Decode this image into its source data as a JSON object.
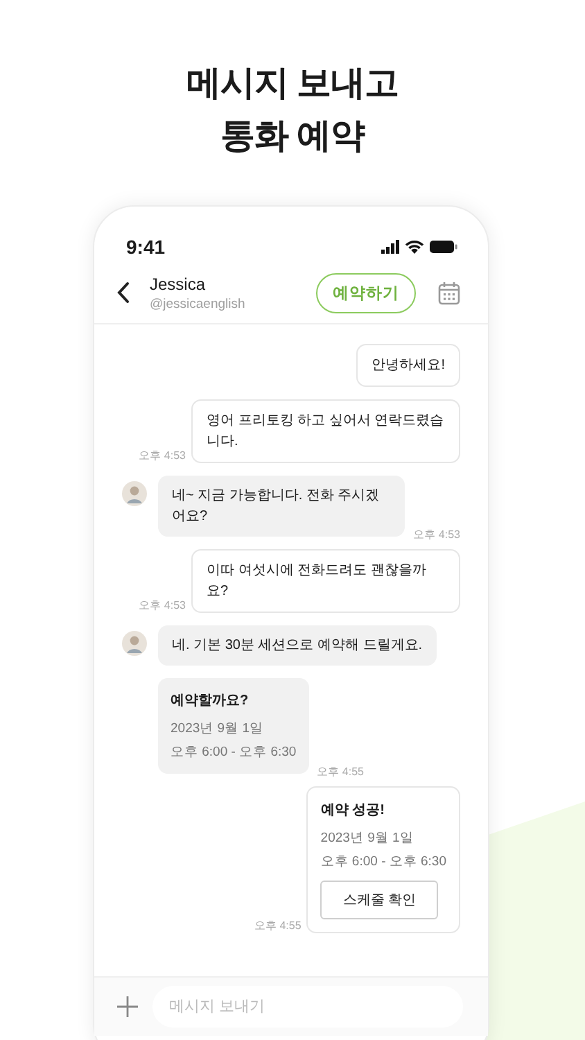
{
  "headline": [
    "메시지 보내고",
    "통화 예약"
  ],
  "status_bar": {
    "time": "9:41"
  },
  "chat_header": {
    "name": "Jessica",
    "handle": "@jessicaenglish",
    "book_button": "예약하기"
  },
  "messages": [
    {
      "outgoing": true,
      "kind": "text",
      "text": "안녕하세요!"
    },
    {
      "outgoing": true,
      "kind": "text",
      "text": "영어 프리토킹 하고 싶어서 연락드렸습니다.",
      "time": "오후 4:53"
    },
    {
      "outgoing": false,
      "kind": "text",
      "text": "네~ 지금 가능합니다. 전화 주시겠어요?",
      "time": "오후 4:53",
      "avatar": true
    },
    {
      "outgoing": true,
      "kind": "text",
      "text": "이따 여섯시에 전화드려도 괜찮을까요?",
      "time": "오후 4:53"
    },
    {
      "outgoing": false,
      "kind": "text",
      "text": "네. 기본 30분 세션으로 예약해 드릴게요.",
      "avatar": true
    },
    {
      "outgoing": false,
      "kind": "booking",
      "title": "예약할까요?",
      "date": "2023년 9월 1일",
      "range": "오후 6:00 - 오후 6:30",
      "time": "오후 4:55",
      "avatar": false
    },
    {
      "outgoing": true,
      "kind": "booking",
      "title": "예약 성공!",
      "date": "2023년 9월 1일",
      "range": "오후 6:00 - 오후 6:30",
      "button": "스케줄 확인",
      "time": "오후 4:55"
    }
  ],
  "composer": {
    "placeholder": "메시지 보내기"
  }
}
